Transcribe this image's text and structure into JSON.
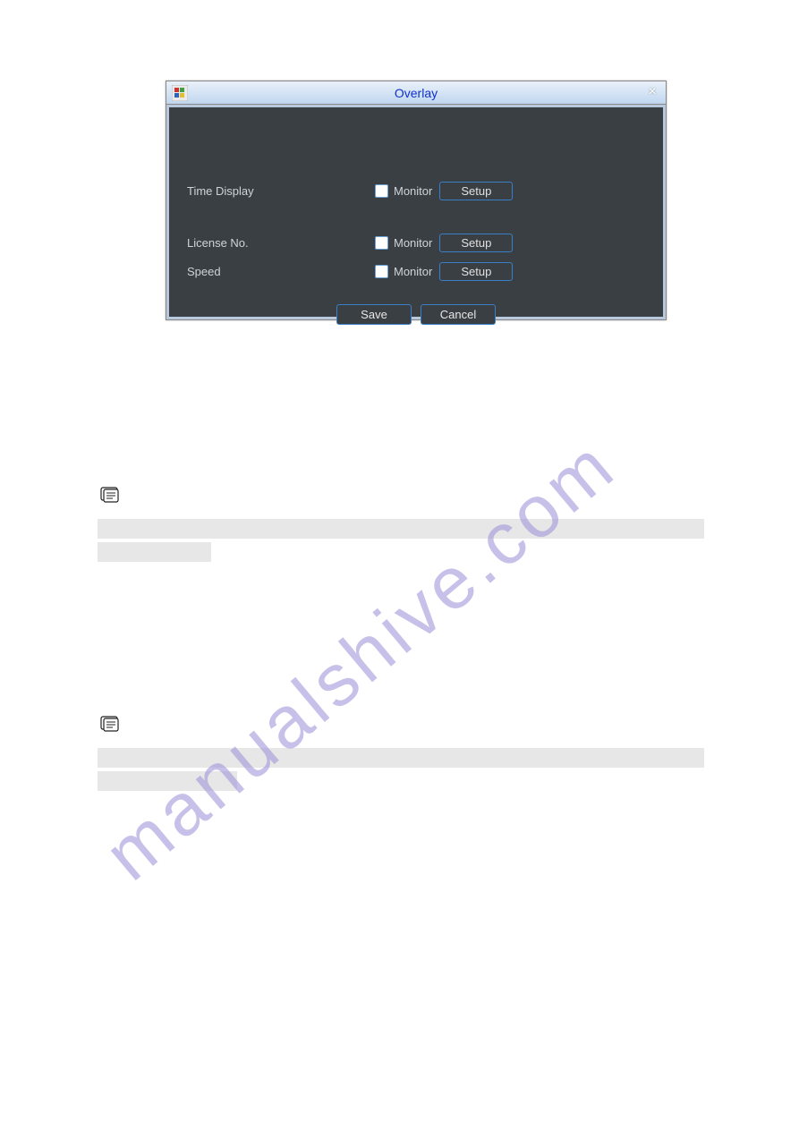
{
  "dialog": {
    "title": "Overlay",
    "rows": [
      {
        "label": "Time Display",
        "monitor_label": "Monitor",
        "setup_label": "Setup"
      },
      {
        "label": "License No.",
        "monitor_label": "Monitor",
        "setup_label": "Setup"
      },
      {
        "label": "Speed",
        "monitor_label": "Monitor",
        "setup_label": "Setup"
      }
    ],
    "buttons": {
      "save": "Save",
      "cancel": "Cancel"
    }
  },
  "watermark": "manualshive.com"
}
